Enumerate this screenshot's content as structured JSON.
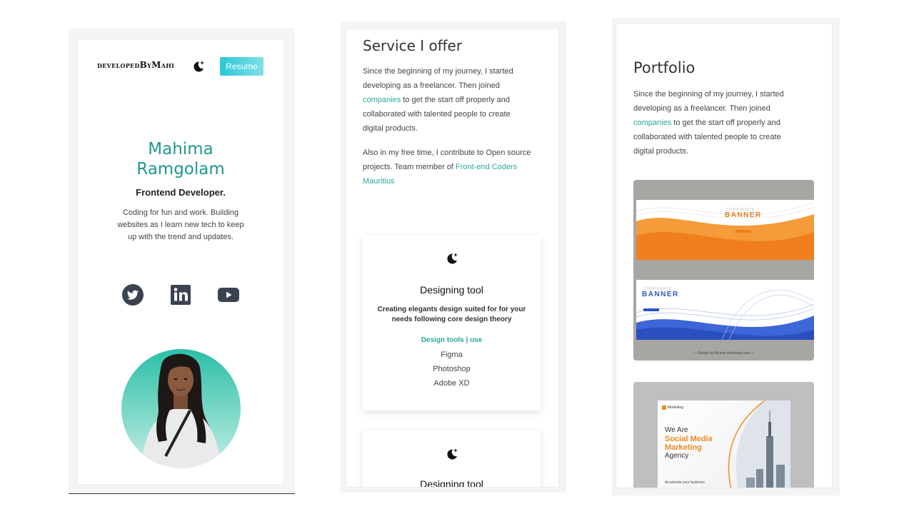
{
  "panel1": {
    "logo": "developedByMahi",
    "resume_label": "Resume",
    "name_line1": "Mahima",
    "name_line2": "Ramgolam",
    "role": "Frontend Developer.",
    "description": "Coding for fun and work. Building websites as I learn new tech to keep up with the trend and updates.",
    "social_icons": [
      "twitter-icon",
      "linkedin-icon",
      "youtube-icon"
    ]
  },
  "panel2": {
    "heading": "Service I offer",
    "para1_before": "Since the beginning of my journey, I started developing as a freelancer. Then joined ",
    "para1_link": "companies",
    "para1_after": " to get the start off properly and collaborated with talented people to create digital products.",
    "para2_before": "Also in my free time, I contribute to Open source projects. Team member of ",
    "para2_link": "Front-end Coders Mauritius",
    "cards": [
      {
        "title": "Designing tool",
        "description": "Creating elegants design suited for for your needs following core design theory",
        "subheading": "Design tools | use",
        "tools": [
          "Figma",
          "Photoshop",
          "Adobe XD"
        ]
      },
      {
        "title": "Designing tool"
      }
    ]
  },
  "panel3": {
    "heading": "Portfolio",
    "para_before": "Since the beginning of my journey, I started developing as a freelancer. Then joined ",
    "para_link": "companies",
    "para_after": " to get the start off properly and collaborated with talented people to create digital products.",
    "thumb1": {
      "banner1_small": "CORPORATE",
      "banner1_big": "BANNER",
      "banner2_small": "CORPORATE",
      "banner2_big": "BANNER",
      "credit": "— Design by All-free-download.com —"
    },
    "thumb2": {
      "brand": "Marketing",
      "line1": "We Are",
      "line2": "Social Media",
      "line3": "Marketing",
      "line4": "Agency",
      "footer": "Accelerate your business"
    }
  },
  "colors": {
    "accent": "#1e9a8a",
    "link": "#2aa89a",
    "resume_start": "#2bc8d6",
    "resume_end": "#7fdfe6",
    "orange": "#f08a24",
    "blue": "#2f55c6"
  }
}
